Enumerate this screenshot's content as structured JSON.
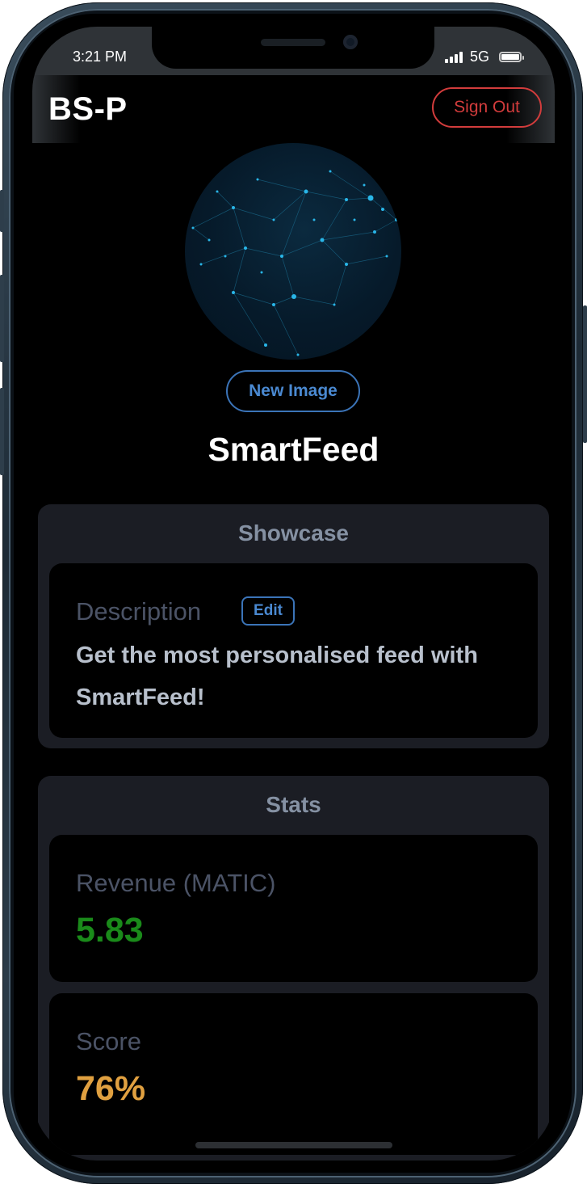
{
  "status_bar": {
    "time": "3:21 PM",
    "network": "5G"
  },
  "header": {
    "title": "BS-P",
    "sign_out_label": "Sign Out"
  },
  "profile": {
    "new_image_label": "New Image",
    "app_name": "SmartFeed"
  },
  "showcase": {
    "title": "Showcase",
    "description_label": "Description",
    "edit_label": "Edit",
    "description_text": "Get the most personalised feed with SmartFeed!"
  },
  "stats": {
    "title": "Stats",
    "revenue_label": "Revenue (MATIC)",
    "revenue_value": "5.83",
    "score_label": "Score",
    "score_value": "76%"
  },
  "colors": {
    "danger": "#d23c3c",
    "accent": "#3b74b8",
    "revenue": "#1a8a1a",
    "score": "#e0a040"
  }
}
